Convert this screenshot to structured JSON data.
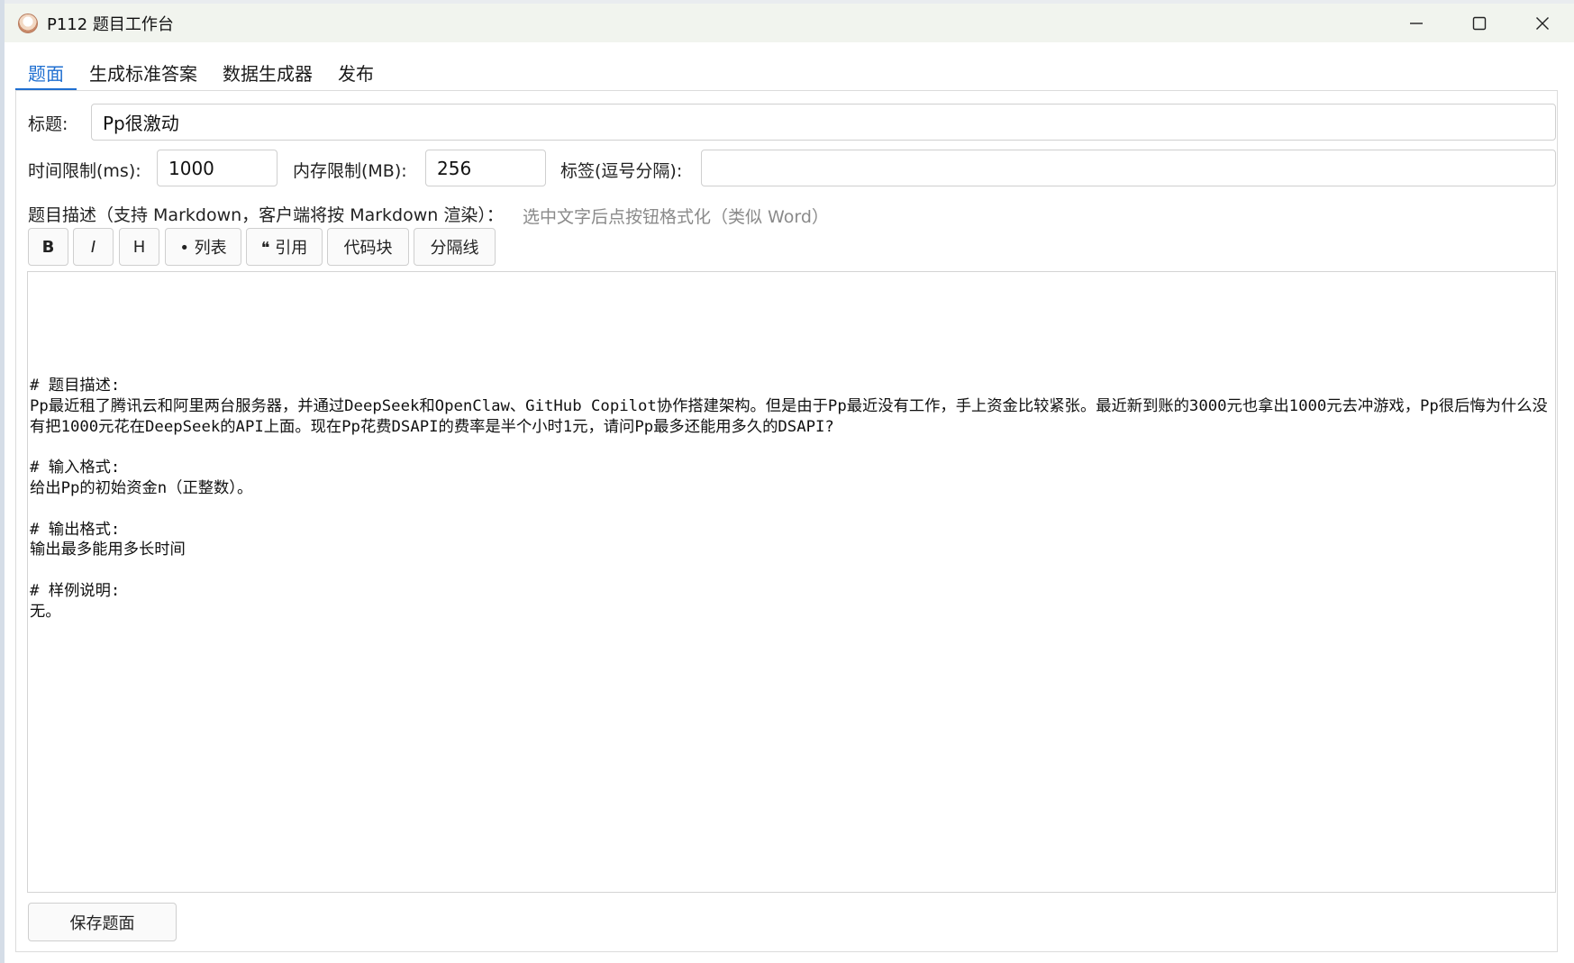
{
  "window": {
    "title": "P112 题目工作台",
    "minimize_icon": "minimize-icon",
    "maximize_icon": "maximize-icon",
    "close_icon": "close-icon"
  },
  "tabs": [
    {
      "label": "题面",
      "active": true
    },
    {
      "label": "生成标准答案",
      "active": false
    },
    {
      "label": "数据生成器",
      "active": false
    },
    {
      "label": "发布",
      "active": false
    }
  ],
  "form": {
    "title_label": "标题:",
    "title_value": "Pp很激动",
    "time_limit_label": "时间限制(ms):",
    "time_limit_value": "1000",
    "memory_limit_label": "内存限制(MB):",
    "memory_limit_value": "256",
    "tags_label": "标签(逗号分隔):",
    "tags_value": ""
  },
  "description": {
    "label": "题目描述（支持 Markdown，客户端将按 Markdown 渲染）：",
    "hint": "选中文字后点按钮格式化（类似 Word）"
  },
  "toolbar": {
    "bold": "B",
    "italic": "I",
    "heading": "H",
    "list": "• 列表",
    "quote": "❝ 引用",
    "code_block": "代码块",
    "divider": "分隔线"
  },
  "editor": {
    "content": "# 题目描述:\nPp最近租了腾讯云和阿里两台服务器，并通过DeepSeek和OpenClaw、GitHub Copilot协作搭建架构。但是由于Pp最近没有工作，手上资金比较紧张。最近新到账的3000元也拿出1000元去冲游戏，Pp很后悔为什么没有把1000元花在DeepSeek的API上面。现在Pp花费DSAPI的费率是半个小时1元，请问Pp最多还能用多久的DSAPI?\n\n# 输入格式:\n给出Pp的初始资金n（正整数）。\n\n# 输出格式:\n输出最多能用多长时间\n\n# 样例说明:\n无。"
  },
  "footer": {
    "save_label": "保存题面"
  }
}
